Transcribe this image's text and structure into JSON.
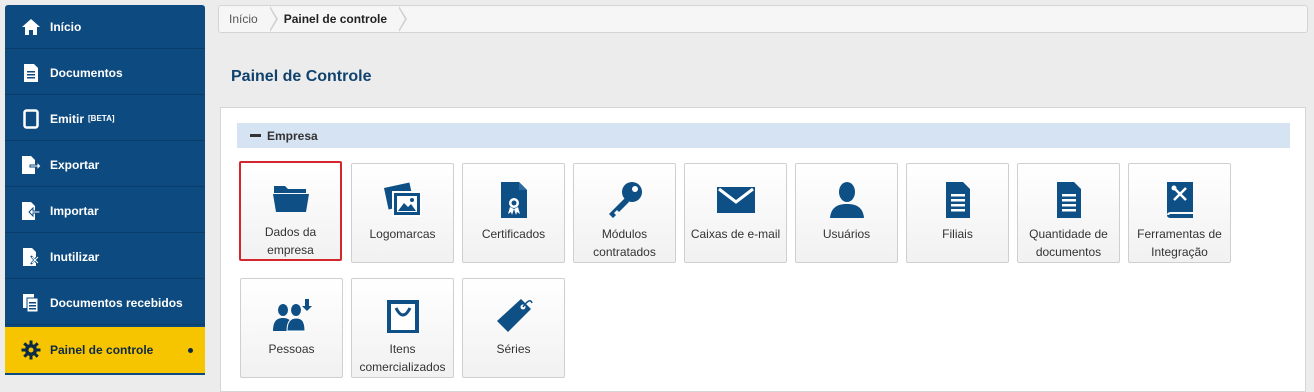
{
  "sidebar": {
    "items": [
      {
        "label": "Início",
        "icon": "home-icon"
      },
      {
        "label": "Documentos",
        "icon": "document-icon"
      },
      {
        "label": "Emitir",
        "badge": "[BETA]",
        "icon": "tablet-icon"
      },
      {
        "label": "Exportar",
        "icon": "export-icon"
      },
      {
        "label": "Importar",
        "icon": "import-icon"
      },
      {
        "label": "Inutilizar",
        "icon": "void-document-icon"
      },
      {
        "label": "Documentos recebidos",
        "icon": "received-documents-icon"
      },
      {
        "label": "Painel de controle",
        "icon": "gear-icon",
        "active": true
      }
    ]
  },
  "breadcrumb": {
    "items": [
      "Início",
      "Painel de controle"
    ]
  },
  "page": {
    "title": "Painel de Controle"
  },
  "section": {
    "title": "Empresa"
  },
  "tiles": [
    {
      "label": "Dados da empresa",
      "icon": "folder-icon",
      "selected": true
    },
    {
      "label": "Logomarcas",
      "icon": "images-icon"
    },
    {
      "label": "Certificados",
      "icon": "certificate-icon"
    },
    {
      "label": "Módulos contratados",
      "icon": "key-icon"
    },
    {
      "label": "Caixas de e-mail",
      "icon": "envelope-icon"
    },
    {
      "label": "Usuários",
      "icon": "user-icon"
    },
    {
      "label": "Filiais",
      "icon": "document-list-icon"
    },
    {
      "label": "Quantidade de documentos",
      "icon": "document-list-icon"
    },
    {
      "label": "Ferramentas de Integração",
      "icon": "tools-book-icon"
    },
    {
      "label": "Pessoas",
      "icon": "people-icon"
    },
    {
      "label": "Itens comercializados",
      "icon": "shopping-bag-icon"
    },
    {
      "label": "Séries",
      "icon": "tag-icon"
    }
  ],
  "colors": {
    "sidebar_bg": "#0d4a7f",
    "active_bg": "#f7c400",
    "icon_blue": "#0e4f86",
    "title_blue": "#10426e",
    "section_bg": "#d6e3f3",
    "selected_border": "#d3262d"
  }
}
